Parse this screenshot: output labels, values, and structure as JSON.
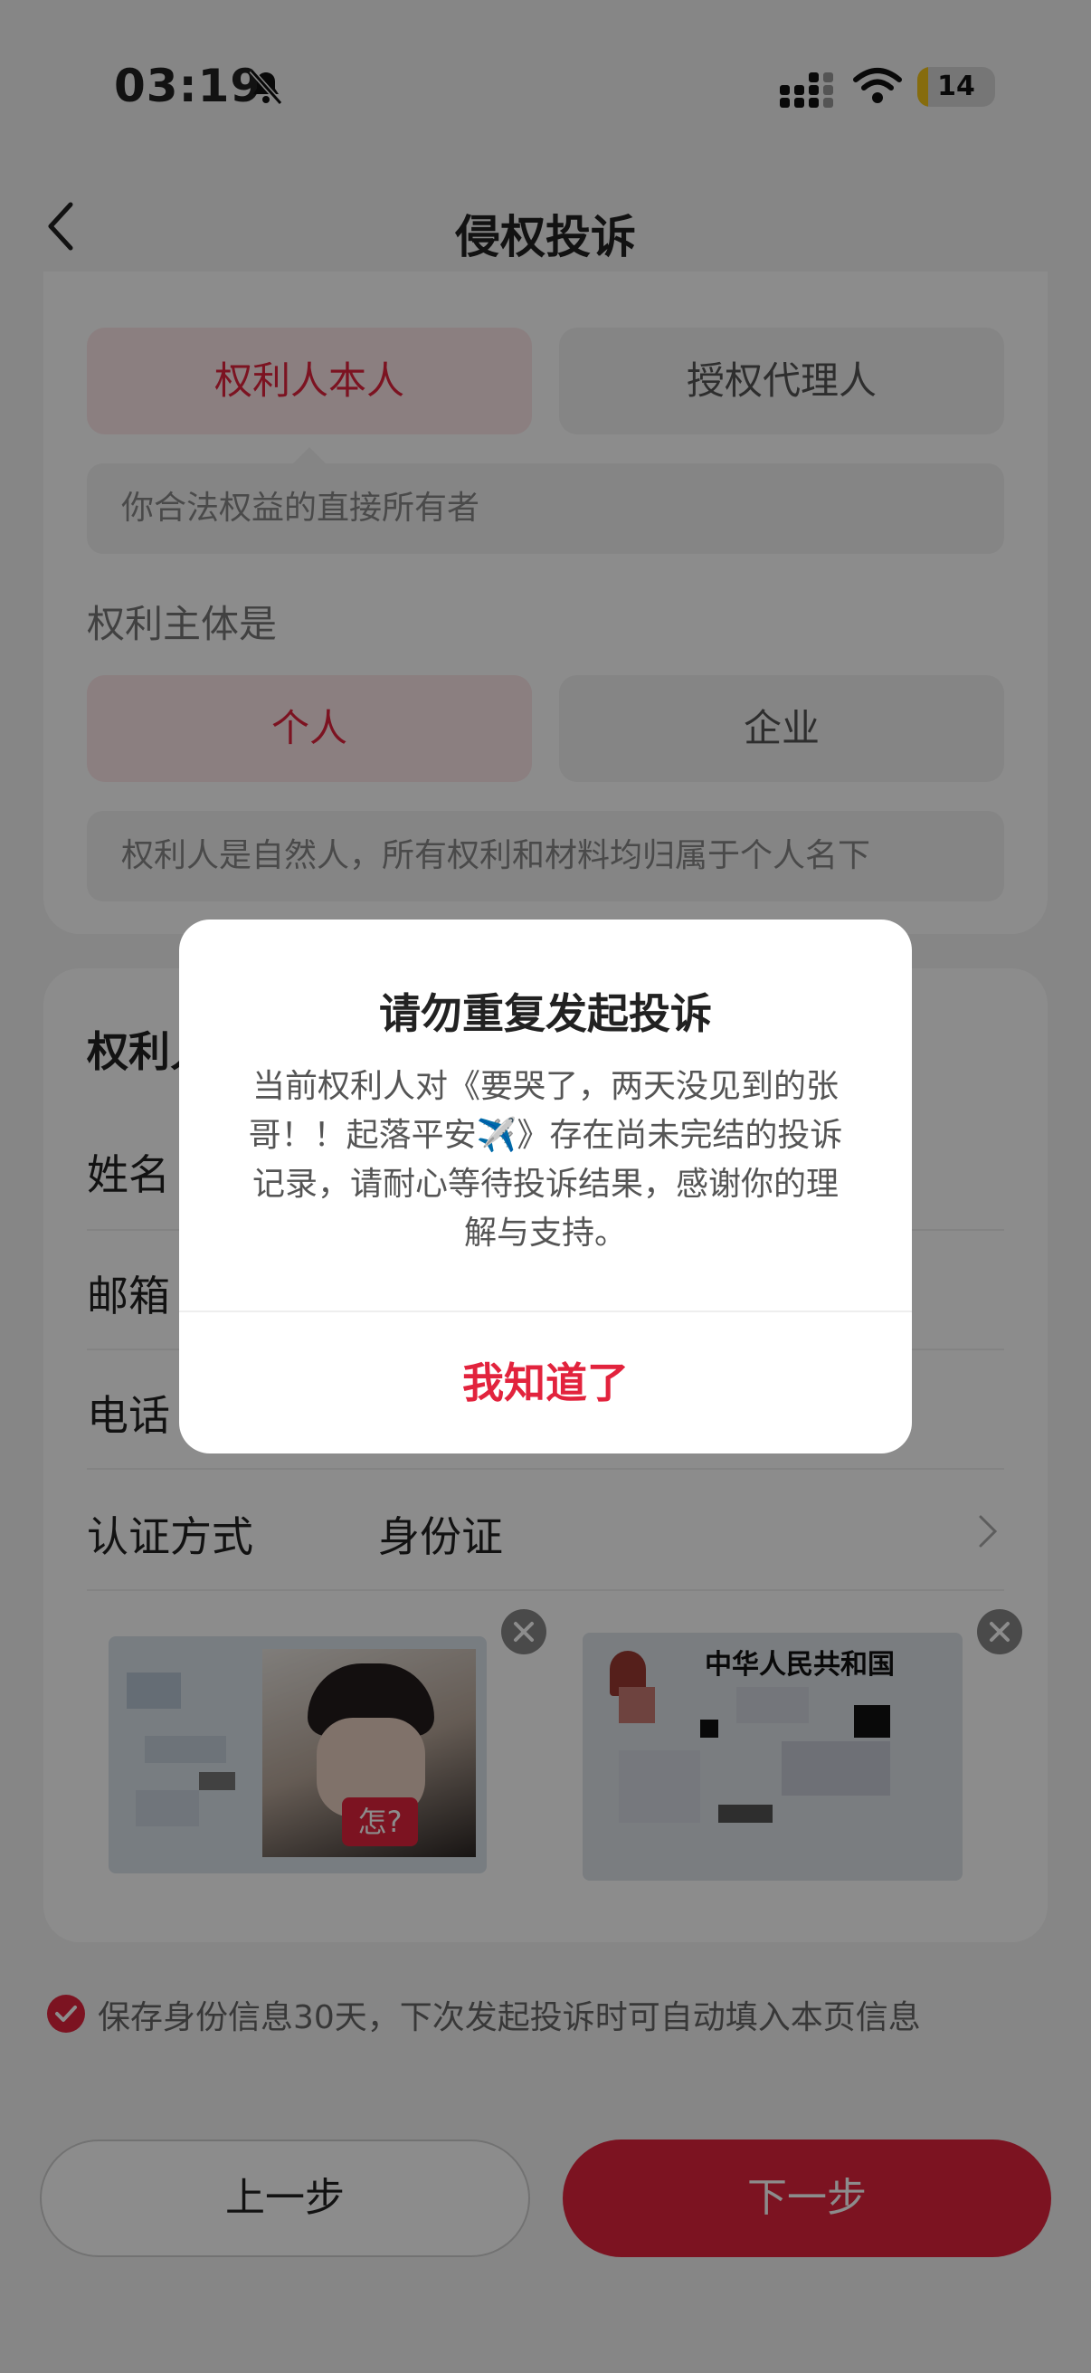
{
  "status_bar": {
    "time": "03:19",
    "battery": "14",
    "battery_level_percent": 14
  },
  "nav": {
    "title": "侵权投诉",
    "back_icon": "chevron-left-icon"
  },
  "identity": {
    "options": [
      "权利人本人",
      "授权代理人"
    ],
    "selected": "权利人本人",
    "hint": "你合法权益的直接所有者"
  },
  "subject": {
    "label": "权利主体是",
    "options": [
      "个人",
      "企业"
    ],
    "selected": "个人",
    "hint": "权利人是自然人，所有权利和材料均归属于个人名下"
  },
  "form": {
    "section_title": "权利人",
    "rows": [
      {
        "label": "姓名"
      },
      {
        "label": "邮箱"
      },
      {
        "label": "电话"
      },
      {
        "label": "认证方式",
        "value": "身份证"
      }
    ],
    "id_back_sticker": "怎?",
    "id_front_header": "中华人民共和国"
  },
  "save_info": {
    "text": "保存身份信息30天，下次发起投诉时可自动填入本页信息",
    "checked": true
  },
  "buttons": {
    "prev": "上一步",
    "next": "下一步"
  },
  "dialog": {
    "title": "请勿重复发起投诉",
    "body": "当前权利人对《要哭了，两天没见到的张哥！！起落平安✈️》存在尚未完结的投诉记录，请耐心等待投诉结果，感谢你的理解与支持。",
    "confirm": "我知道了"
  },
  "colors": {
    "accent": "#e2233d",
    "accent_light": "#fde7ea",
    "background": "#f4f4f4"
  }
}
